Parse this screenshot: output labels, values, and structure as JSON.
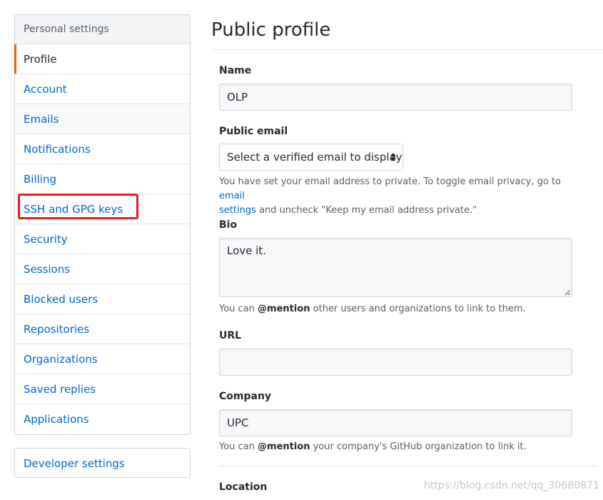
{
  "sidebar": {
    "header": "Personal settings",
    "items": [
      {
        "label": "Profile"
      },
      {
        "label": "Account"
      },
      {
        "label": "Emails"
      },
      {
        "label": "Notifications"
      },
      {
        "label": "Billing"
      },
      {
        "label": "SSH and GPG keys"
      },
      {
        "label": "Security"
      },
      {
        "label": "Sessions"
      },
      {
        "label": "Blocked users"
      },
      {
        "label": "Repositories"
      },
      {
        "label": "Organizations"
      },
      {
        "label": "Saved replies"
      },
      {
        "label": "Applications"
      }
    ],
    "developer_settings": "Developer settings"
  },
  "main": {
    "title": "Public profile",
    "name": {
      "label": "Name",
      "value": "OLP"
    },
    "public_email": {
      "label": "Public email",
      "selected": "Select a verified email to display",
      "note_before": "You have set your email address to private. To toggle email privacy, go to ",
      "note_link_1": "email",
      "note_link_2": "settings",
      "note_after": " and uncheck \"Keep my email address private.\""
    },
    "bio": {
      "label": "Bio",
      "value": "Love it.",
      "note_before": "You can ",
      "note_mention": "@mention",
      "note_after": " other users and organizations to link to them."
    },
    "url": {
      "label": "URL",
      "value": ""
    },
    "company": {
      "label": "Company",
      "value": "UPC",
      "note_before": "You can ",
      "note_mention": "@mention",
      "note_after": " your company's GitHub organization to link it."
    },
    "location": {
      "label": "Location"
    }
  },
  "watermark": "https://blog.csdn.net/qq_30680871",
  "colors": {
    "link": "#0366d6",
    "selected_accent": "#e36209",
    "highlight_box": "#ee1c1c"
  }
}
